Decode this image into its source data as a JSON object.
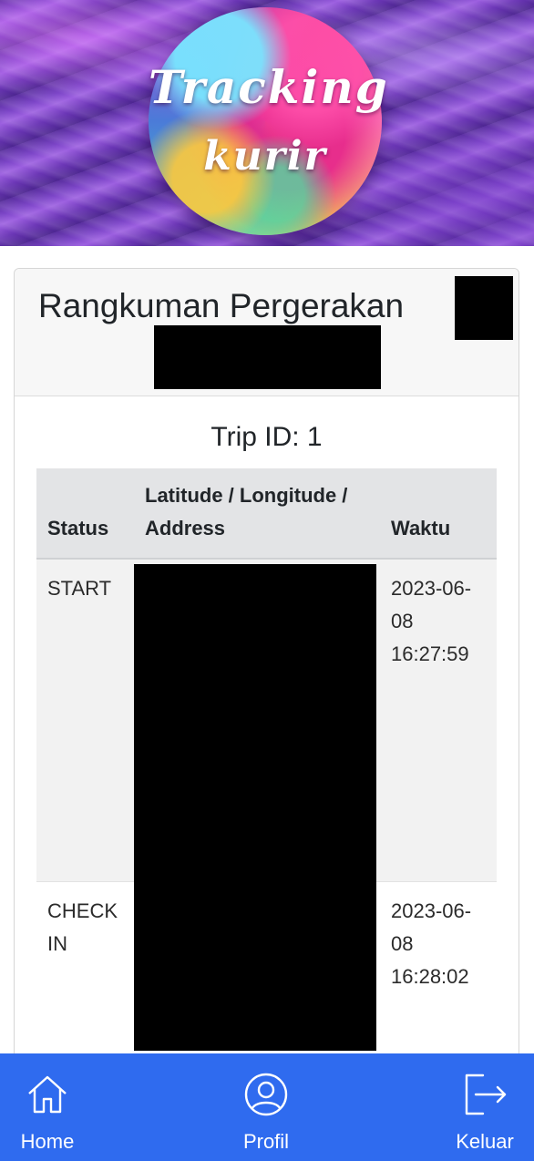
{
  "banner": {
    "title_line1": "Tracking",
    "title_line2": "kurir"
  },
  "card": {
    "title": "Rangkuman Pergerakan",
    "trip_id": "Trip ID: 1"
  },
  "table": {
    "headers": {
      "status": "Status",
      "address": "Latitude / Longitude / Address",
      "time": "Waktu"
    },
    "rows": [
      {
        "status": "START",
        "time": "2023-06-08 16:27:59"
      },
      {
        "status": "CHECK IN",
        "time": "2023-06-08 16:28:02"
      }
    ]
  },
  "nav": {
    "home": "Home",
    "profil": "Profil",
    "keluar": "Keluar"
  },
  "colors": {
    "nav_background": "#2f6bef",
    "table_header": "#e3e4e6",
    "redaction": "#000000"
  },
  "icons": {
    "home": "home-icon",
    "profil": "user-circle-icon",
    "keluar": "logout-icon"
  }
}
